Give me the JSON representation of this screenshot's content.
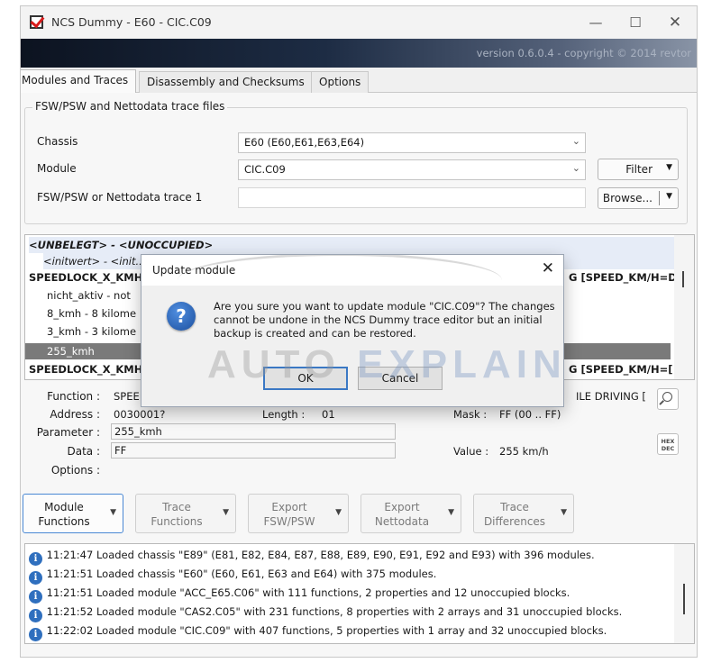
{
  "window": {
    "title": "NCS Dummy - E60 - CIC.C09",
    "banner": "version 0.6.0.4 - copyright © 2014 revtor"
  },
  "tabs": [
    {
      "label": "Modules and Traces",
      "active": true
    },
    {
      "label": "Disassembly and Checksums",
      "active": false
    },
    {
      "label": "Options",
      "active": false
    }
  ],
  "files_group": {
    "title": "FSW/PSW and Nettodata trace files",
    "chassis_label": "Chassis",
    "chassis_value": "E60  (E60,E61,E63,E64)",
    "module_label": "Module",
    "module_value": "CIC.C09",
    "trace_label": "FSW/PSW or Nettodata trace 1",
    "trace_value": "",
    "filter_label": "Filter",
    "browse_label": "Browse..."
  },
  "tree": {
    "lines": [
      {
        "text": "<UNBELEGT> - <UNOCCUPIED>"
      },
      {
        "text": "<initwert> - <init..."
      },
      {
        "text": "SPEEDLOCK_X_KMH_",
        "right": "G [SPEED_KM/H=D"
      },
      {
        "text": "nicht_aktiv - not"
      },
      {
        "text": "8_kmh - 8 kilome"
      },
      {
        "text": "3_kmh - 3 kilome"
      },
      {
        "text": "255_kmh"
      },
      {
        "text": "SPEEDLOCK_X_KMH_",
        "right": "G [SPEED_KM/H=["
      }
    ]
  },
  "details": {
    "function_label": "Function :",
    "function_value": "SPEE",
    "function_right": "ILE DRIVING [",
    "address_label": "Address :",
    "address_value": "0030001?",
    "length_label": "Length :",
    "length_value": "01",
    "mask_label": "Mask :",
    "mask_value": "FF (00 .. FF)",
    "parameter_label": "Parameter :",
    "parameter_value": "255_kmh",
    "data_label": "Data :",
    "data_value": "FF",
    "value_label": "Value :",
    "value_value": "255 km/h",
    "options_label": "Options :",
    "hex_top": "HEX",
    "hex_bottom": "DEC"
  },
  "buttons": [
    {
      "l1": "Module",
      "l2": "Functions"
    },
    {
      "l1": "Trace",
      "l2": "Functions"
    },
    {
      "l1": "Export",
      "l2": "FSW/PSW"
    },
    {
      "l1": "Export",
      "l2": "Nettodata"
    },
    {
      "l1": "Trace",
      "l2": "Differences"
    }
  ],
  "log": [
    "11:21:47  Loaded chassis \"E89\" (E81, E82, E84, E87, E88, E89, E90, E91, E92 and E93) with 396 modules.",
    "11:21:51  Loaded chassis \"E60\" (E60, E61, E63 and E64) with 375 modules.",
    "11:21:51  Loaded module \"ACC_E65.C06\" with 111 functions, 2 properties and 12 unoccupied blocks.",
    "11:21:52  Loaded module \"CAS2.C05\" with 231 functions, 8 properties with 2 arrays and 31 unoccupied blocks.",
    "11:22:02  Loaded module \"CIC.C09\" with 407 functions, 5 properties with 1 array and 32 unoccupied blocks."
  ],
  "dialog": {
    "title": "Update module",
    "message": "Are you sure you want to update module \"CIC.C09\"? The changes cannot be undone in the NCS Dummy trace editor but an initial backup is created and can be restored.",
    "ok": "OK",
    "cancel": "Cancel"
  },
  "watermark": {
    "part1": "AUTO ",
    "part2": "EXPLAIN"
  },
  "colors": {
    "accent": "#3b78c4",
    "info": "#2f6fbe",
    "selected_row": "#7a7a7a"
  }
}
